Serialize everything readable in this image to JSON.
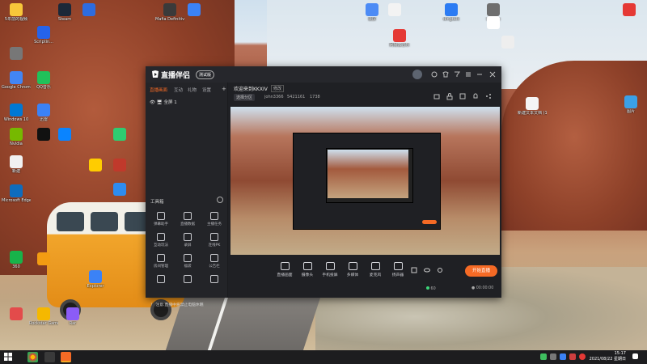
{
  "desktop": {
    "icons": [
      {
        "label": "5年前的视频",
        "color": "#f7c73a"
      },
      {
        "label": "Steam",
        "color": "#1b2838"
      },
      {
        "label": "",
        "color": "#2d6cdf"
      },
      {
        "label": "Mafia Definitive",
        "color": "#3a3a3a"
      },
      {
        "label": "录屏",
        "color": "#4c8bf5"
      },
      {
        "label": "",
        "color": "#f3f3f3"
      },
      {
        "label": "",
        "color": "#e9c46a"
      },
      {
        "label": "Dwarfs",
        "color": "#6e6e6e"
      },
      {
        "label": "",
        "color": "#3b82f6"
      },
      {
        "label": "网易云音乐",
        "color": "#e53935"
      },
      {
        "label": "dingtalk",
        "color": "#2b7bf3"
      },
      {
        "label": "",
        "color": "#ffffff"
      },
      {
        "label": "",
        "color": "#e53935"
      },
      {
        "label": "",
        "color": "#eeeeee"
      },
      {
        "label": "Scriptin...",
        "color": "#2563eb"
      },
      {
        "label": "",
        "color": "#777777"
      },
      {
        "label": "Google Chrome",
        "color": "#4285f4"
      },
      {
        "label": "QQ音乐",
        "color": "#21c15a"
      },
      {
        "label": "Windows 10",
        "color": "#0078d4"
      },
      {
        "label": "迅雷",
        "color": "#3b82f6"
      },
      {
        "label": "Microsoft Edge",
        "color": "#0f6cbd"
      },
      {
        "label": "Explorer",
        "color": "#3b82f6"
      },
      {
        "label": "Rockstar Games",
        "color": "#f5b800"
      },
      {
        "label": "",
        "color": "#e34b4b"
      },
      {
        "label": "Rar",
        "color": "#8b5cf6"
      },
      {
        "label": "新建文本文档 (1)",
        "color": "#f5f5f5"
      },
      {
        "label": "Nvidia",
        "color": "#76b900"
      },
      {
        "label": "新建",
        "color": "#f1f1f1"
      },
      {
        "label": "图片",
        "color": "#3aa0e8"
      },
      {
        "label": "",
        "color": "#111111"
      },
      {
        "label": "",
        "color": "#0a84ff"
      },
      {
        "label": "360",
        "color": "#18b34a"
      },
      {
        "label": "",
        "color": "#f39c12"
      },
      {
        "label": "",
        "color": "#2ecc71"
      },
      {
        "label": "",
        "color": "#ffcc00"
      },
      {
        "label": "",
        "color": "#c0392b"
      },
      {
        "label": "",
        "color": "#2d8cf0"
      }
    ]
  },
  "app": {
    "name": "直播伴侣",
    "badge": "测试版",
    "sidebar": {
      "tabs": [
        "直播画面",
        "互动",
        "礼物",
        "设置"
      ],
      "scene_label": "全屏 1",
      "tools_title": "工具箱",
      "tools": [
        "弹幕助手",
        "直播数据",
        "主播任务",
        "互动玩法",
        "录屏",
        "连线PK",
        "房间管理",
        "福袋",
        "公告栏",
        "",
        "",
        ""
      ],
      "warning": "！ 注意:直播中将禁止电脑休眠"
    },
    "info": {
      "title": "欢迎来到KKXIV",
      "edit": "修改",
      "category": "选择分区",
      "user": "john3366",
      "room": "5421161",
      "fans": "1738"
    },
    "controls": [
      {
        "label": "直播画面"
      },
      {
        "label": "摄像头"
      },
      {
        "label": "手机投屏"
      },
      {
        "label": "多媒体"
      },
      {
        "label": "麦克风"
      },
      {
        "label": "扬声器"
      }
    ],
    "start_label": "开始直播",
    "status": {
      "fps": "60",
      "time": "00:00:00"
    }
  },
  "taskbar": {
    "time": "15:17",
    "date": "2021/08/22 星期日"
  }
}
